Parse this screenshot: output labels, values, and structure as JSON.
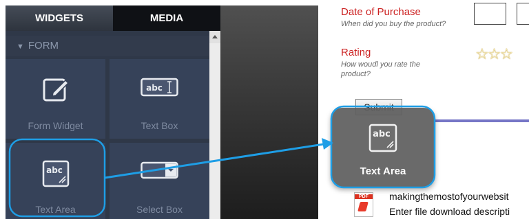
{
  "tabs": [
    {
      "label": "WIDGETS",
      "active": true
    },
    {
      "label": "MEDIA",
      "active": false
    }
  ],
  "section": {
    "label": "FORM",
    "icon": "triangle-down-icon"
  },
  "widgets": [
    {
      "label": "Form Widget",
      "icon": "edit-form-icon"
    },
    {
      "label": "Text Box",
      "icon": "text-box-icon"
    },
    {
      "label": "Text Area",
      "icon": "text-area-icon"
    },
    {
      "label": "Select Box",
      "icon": "select-box-icon"
    }
  ],
  "form": {
    "date_label": "Date of Purchase",
    "date_help": "When did you buy the product?",
    "rating_label": "Rating",
    "rating_help": "How woudl you rate the product?",
    "submit_label": "Submit",
    "file_name": "makingthemostofyourwebsit",
    "file_desc": "Enter file download descripti"
  },
  "drag": {
    "label": "Text Area",
    "icon": "text-area-icon"
  },
  "colors": {
    "highlight": "#1e9ee6",
    "form_label": "#cc2222",
    "panel": "#2f3848"
  },
  "icon_text": "abc"
}
